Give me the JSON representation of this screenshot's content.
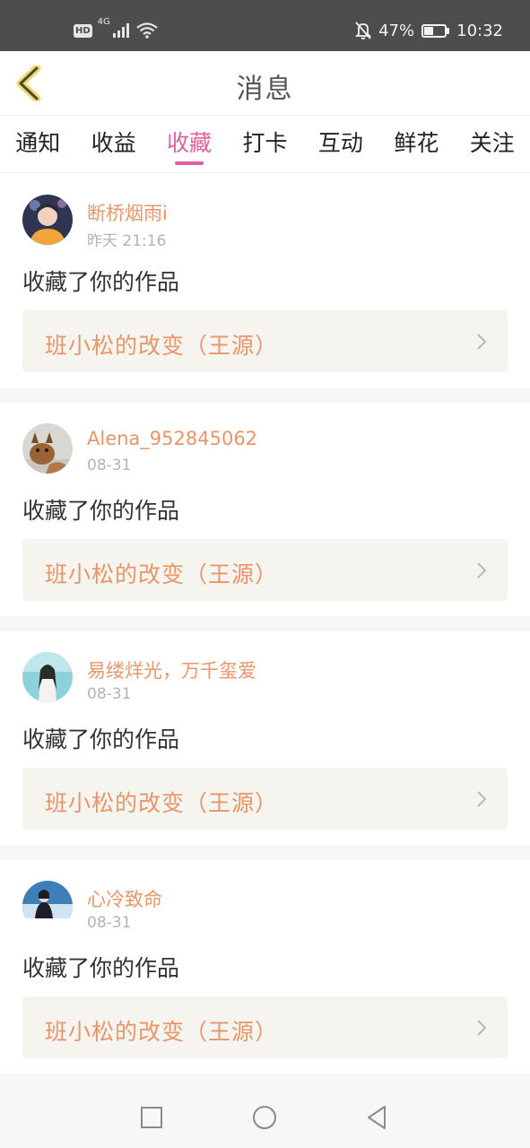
{
  "status_bar": {
    "hd": "HD",
    "network": "4G",
    "battery_percent": "47%",
    "battery_level": 0.47,
    "time": "10:32",
    "icons": [
      "signal-icon",
      "wifi-icon",
      "mute-bell-icon",
      "battery-icon"
    ]
  },
  "header": {
    "title": "消息",
    "back_icon": "chevron-left-icon"
  },
  "tabs": [
    {
      "label": "通知",
      "active": false
    },
    {
      "label": "收益",
      "active": false
    },
    {
      "label": "收藏",
      "active": true
    },
    {
      "label": "打卡",
      "active": false
    },
    {
      "label": "互动",
      "active": false
    },
    {
      "label": "鲜花",
      "active": false
    },
    {
      "label": "关注",
      "active": false
    }
  ],
  "colors": {
    "accent_pink": "#e0609b",
    "username_orange": "#e8956a",
    "status_bar_bg": "#4d4d4d",
    "link_bg": "#f5f4ee"
  },
  "messages": [
    {
      "username": "断桥烟雨i",
      "time": "昨天 21:16",
      "action": "收藏了你的作品",
      "work_title": "班小松的改变（王源）"
    },
    {
      "username": "Alena_952845062",
      "time": "08-31",
      "action": "收藏了你的作品",
      "work_title": "班小松的改变（王源）"
    },
    {
      "username": "易缕烊光，万千玺爱",
      "time": "08-31",
      "action": "收藏了你的作品",
      "work_title": "班小松的改变（王源）"
    },
    {
      "username": "心冷致命",
      "time": "08-31",
      "action": "收藏了你的作品",
      "work_title": "班小松的改变（王源）"
    }
  ],
  "nav_bar": {
    "icons": [
      "recent-apps-icon",
      "home-icon",
      "back-icon"
    ]
  }
}
